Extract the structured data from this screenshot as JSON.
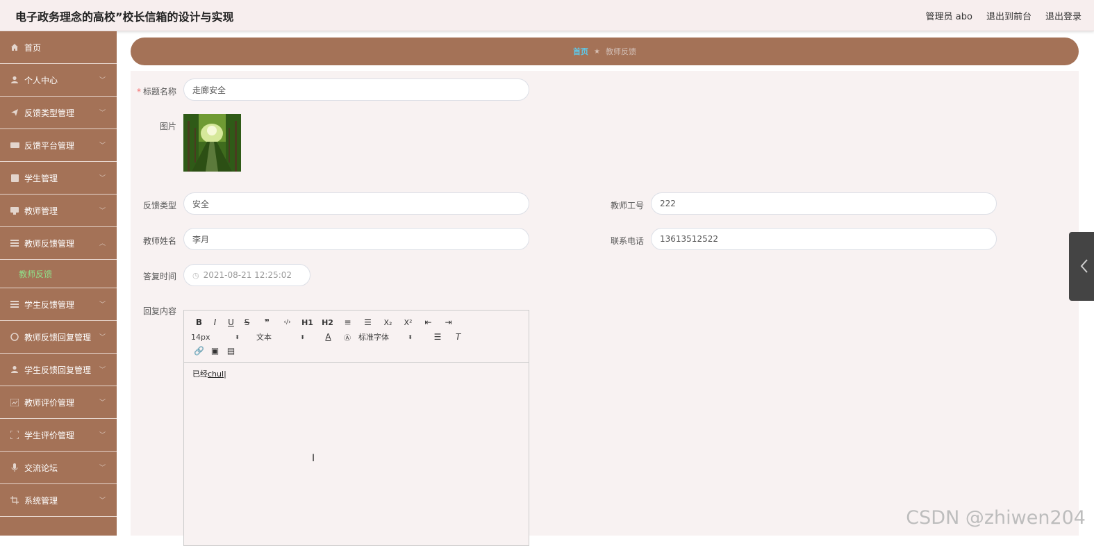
{
  "app": {
    "title": "电子政务理念的高校”校长信箱的设计与实现",
    "user_label": "管理员 abo",
    "to_front": "退出到前台",
    "logout": "退出登录"
  },
  "sidebar": {
    "items": [
      {
        "label": "首页",
        "icon": "home-icon"
      },
      {
        "label": "个人中心",
        "icon": "user-icon"
      },
      {
        "label": "反馈类型管理",
        "icon": "send-icon"
      },
      {
        "label": "反馈平台管理",
        "icon": "ticket-icon"
      },
      {
        "label": "学生管理",
        "icon": "clipboard-icon"
      },
      {
        "label": "教师管理",
        "icon": "monitor-icon"
      },
      {
        "label": "教师反馈管理",
        "icon": "list-icon"
      },
      {
        "label": "学生反馈管理",
        "icon": "list-icon"
      },
      {
        "label": "教师反馈回复管理",
        "icon": "help-circle-icon"
      },
      {
        "label": "学生反馈回复管理",
        "icon": "user-icon"
      },
      {
        "label": "教师评价管理",
        "icon": "chart-icon"
      },
      {
        "label": "学生评价管理",
        "icon": "scan-icon"
      },
      {
        "label": "交流论坛",
        "icon": "mic-icon"
      },
      {
        "label": "系统管理",
        "icon": "crop-icon"
      }
    ],
    "active_sub": "教师反馈"
  },
  "breadcrumb": {
    "home": "首页",
    "separator": "★",
    "current": "教师反馈"
  },
  "form": {
    "title_label": "标题名称",
    "title_value": "走廊安全",
    "image_label": "图片",
    "type_label": "反馈类型",
    "type_value": "安全",
    "teacher_no_label": "教师工号",
    "teacher_no_value": "222",
    "teacher_name_label": "教师姓名",
    "teacher_name_value": "李月",
    "phone_label": "联系电话",
    "phone_value": "13613512522",
    "reply_time_label": "答复时间",
    "reply_time_value": "2021-08-21 12:25:02",
    "reply_content_label": "回复内容",
    "reply_content_prefix": "已经",
    "reply_content_typing": "chul"
  },
  "editor": {
    "font_size": "14px",
    "text_type": "文本",
    "font_family": "标准字体",
    "buttons_row1": [
      "B",
      "I",
      "U",
      "S",
      "❞",
      "‹/›",
      "H1",
      "H2",
      "≡",
      "☰",
      "X₂",
      "X²",
      "⇤",
      "⇥"
    ]
  },
  "watermark": "CSDN @zhiwen204",
  "colors": {
    "accent": "#a47257",
    "breadcrumb_home": "#5ec8e8",
    "active_sub": "#8fe08a"
  }
}
